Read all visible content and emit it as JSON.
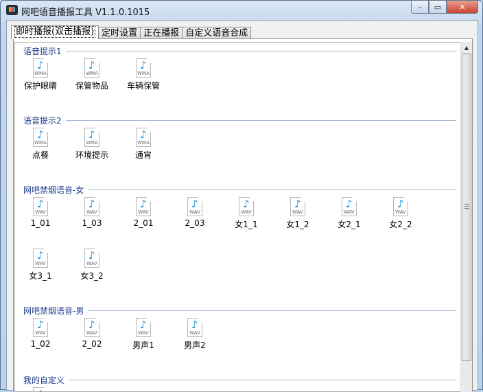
{
  "window": {
    "title": "网吧语音播报工具 V1.1.0.1015",
    "minimize": "–",
    "maximize": "▭",
    "close": "✕"
  },
  "tabs": [
    {
      "label": "即时播报(双击播报)"
    },
    {
      "label": "定时设置"
    },
    {
      "label": "正在播报"
    },
    {
      "label": "自定义语音合成"
    }
  ],
  "sections": [
    {
      "title": "语音提示1",
      "items": [
        {
          "label": "保护眼睛",
          "type": "WMA"
        },
        {
          "label": "保管物品",
          "type": "WMA"
        },
        {
          "label": "车辆保管",
          "type": "WMA"
        }
      ]
    },
    {
      "title": "语音提示2",
      "items": [
        {
          "label": "点餐",
          "type": "WMA"
        },
        {
          "label": "环境提示",
          "type": "WMA"
        },
        {
          "label": "通宵",
          "type": "WMA"
        }
      ]
    },
    {
      "title": "网吧禁烟语音-女",
      "items": [
        {
          "label": "1_01",
          "type": "WAV"
        },
        {
          "label": "1_03",
          "type": "WAV"
        },
        {
          "label": "2_01",
          "type": "WAV"
        },
        {
          "label": "2_03",
          "type": "WAV"
        },
        {
          "label": "女1_1",
          "type": "WAV"
        },
        {
          "label": "女1_2",
          "type": "WAV"
        },
        {
          "label": "女2_1",
          "type": "WAV"
        },
        {
          "label": "女2_2",
          "type": "WAV"
        },
        {
          "label": "女3_1",
          "type": "WAV"
        },
        {
          "label": "女3_2",
          "type": "WAV"
        }
      ]
    },
    {
      "title": "网吧禁烟语音-男",
      "items": [
        {
          "label": "1_02",
          "type": "WAV"
        },
        {
          "label": "2_02",
          "type": "WAV"
        },
        {
          "label": "男声1",
          "type": "WAV"
        },
        {
          "label": "男声2",
          "type": "WAV"
        }
      ]
    },
    {
      "title": "我的自定义",
      "items": [
        {
          "label": "",
          "type": ""
        }
      ]
    }
  ],
  "colors": {
    "section_title": "#1e3c8c",
    "note": "#1e8fd8"
  }
}
